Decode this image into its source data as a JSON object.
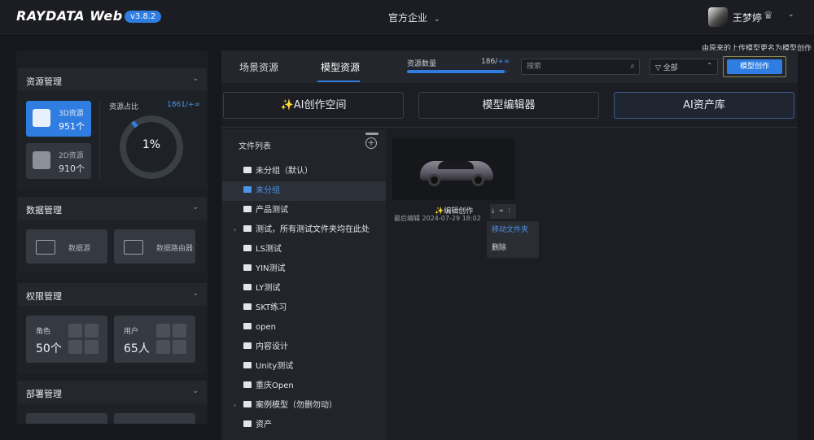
{
  "app": {
    "logo": "RAYDATA Web",
    "version": "v3.8.2"
  },
  "header": {
    "org": "官方企业",
    "user": "王梦婷"
  },
  "sidebar": {
    "resource": {
      "title": "资源管理",
      "res3d_label": "3D资源",
      "res3d_count": "951个",
      "res2d_label": "2D资源",
      "res2d_count": "910个",
      "ratio_label": "资源占比",
      "ratio_value": "1861/+∞",
      "ratio_percent": "1%",
      "ratio_fraction": 0.01
    },
    "data": {
      "title": "数据管理",
      "db_label": "数据源",
      "router_label": "数据路由器"
    },
    "perm": {
      "title": "权限管理",
      "role_label": "角色",
      "role_count": "50个",
      "user_label": "用户",
      "user_count": "65人"
    },
    "deploy": {
      "title": "部署管理"
    }
  },
  "hint": "由原来的上传模型更名为模型创作",
  "main": {
    "tabs": [
      {
        "label": "场景资源"
      },
      {
        "label": "模型资源"
      }
    ],
    "qty_label": "资源数量",
    "qty_value": "186/",
    "qty_inf": "+∞",
    "qty_fraction": 0.97,
    "search_placeholder": "搜索",
    "filter_label": "全部",
    "create_label": "模型创作",
    "big_buttons": [
      "✨AI创作空间",
      "模型编辑器",
      "AI资产库"
    ]
  },
  "filelist": {
    "title": "文件列表",
    "items": [
      {
        "label": "未分组（默认）",
        "caret": false
      },
      {
        "label": "未分组",
        "caret": false,
        "selected": true
      },
      {
        "label": "产品测试",
        "caret": false
      },
      {
        "label": "测试，所有测试文件夹均在此处",
        "caret": true
      },
      {
        "label": "LS测试",
        "caret": false
      },
      {
        "label": "YIN测试",
        "caret": false
      },
      {
        "label": "LY测试",
        "caret": false
      },
      {
        "label": "SKT练习",
        "caret": false
      },
      {
        "label": "open",
        "caret": false
      },
      {
        "label": "内容设计",
        "caret": false
      },
      {
        "label": "Unity测试",
        "caret": false
      },
      {
        "label": "重庆Open",
        "caret": false
      },
      {
        "label": "案例模型（勿删勿动）",
        "caret": true
      },
      {
        "label": "资产",
        "caret": false
      }
    ]
  },
  "card": {
    "title": "✨编辑创作",
    "edited": "最后编辑 2024-07-29  18:02"
  },
  "context_menu": {
    "move": "移动文件夹",
    "delete": "删除"
  },
  "icons": {
    "chevron": "chevron-down-icon",
    "search": "search-icon",
    "filter": "filter-icon",
    "crown": "crown-icon",
    "add": "add-folder-icon",
    "folder": "folder-icon"
  },
  "colors": {
    "accent": "#2f7de1",
    "bg": "#16181d",
    "panel": "#1c1e23"
  }
}
